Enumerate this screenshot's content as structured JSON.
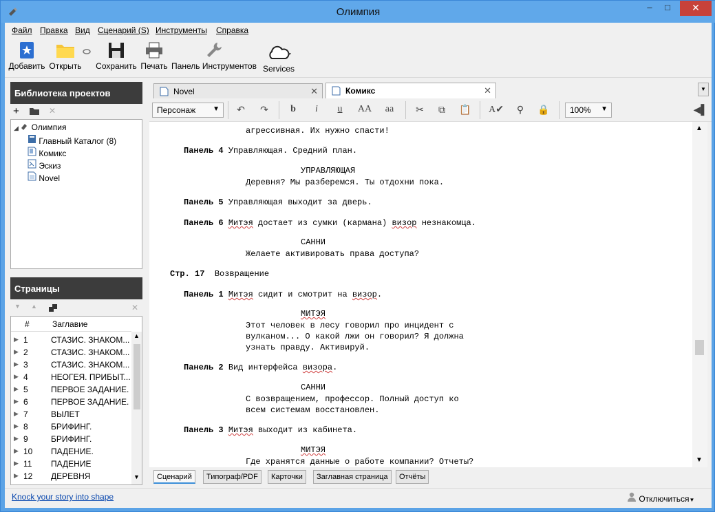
{
  "window": {
    "title": "Олимпия",
    "minimize": "–",
    "maximize": "□",
    "close": "✕"
  },
  "menu": [
    "Файл",
    "Правка",
    "Вид",
    "Сценарий (S)",
    "Инструменты",
    "Справка"
  ],
  "toolbar": {
    "add": "Добавить",
    "open": "Открыть",
    "save": "Сохранить",
    "print": "Печать",
    "panel": "Панель Инструментов",
    "services": "Services"
  },
  "library": {
    "header": "Библиотека проектов",
    "items": [
      "Олимпия",
      "Главный Каталог (8)",
      "Комикс",
      "Эскиз",
      "Novel"
    ]
  },
  "pages": {
    "header": "Страницы",
    "col_num": "#",
    "col_title": "Заглавие",
    "rows": [
      {
        "n": "1",
        "t": "СТАЗИС. ЗНАКОМ..."
      },
      {
        "n": "2",
        "t": "СТАЗИС. ЗНАКОМ..."
      },
      {
        "n": "3",
        "t": "СТАЗИС. ЗНАКОМ..."
      },
      {
        "n": "4",
        "t": "НЕОГЕЯ. ПРИБЫТ..."
      },
      {
        "n": "5",
        "t": "ПЕРВОЕ ЗАДАНИЕ."
      },
      {
        "n": "6",
        "t": "ПЕРВОЕ ЗАДАНИЕ."
      },
      {
        "n": "7",
        "t": "ВЫЛЕТ"
      },
      {
        "n": "8",
        "t": "БРИФИНГ."
      },
      {
        "n": "9",
        "t": "БРИФИНГ."
      },
      {
        "n": "10",
        "t": "ПАДЕНИЕ."
      },
      {
        "n": "11",
        "t": "ПАДЕНИЕ"
      },
      {
        "n": "12",
        "t": "ДЕРЕВНЯ"
      }
    ]
  },
  "tabs": {
    "novel": "Novel",
    "comics": "Комикс",
    "close": "✕"
  },
  "format": {
    "style": "Персонаж",
    "zoom": "100%"
  },
  "script": {
    "l1": "агрессивная. Их нужно спасти!",
    "p4_label": "Панель 4",
    "p4_text": "Управляющая. Средний план.",
    "char1": "УПРАВЛЯЮЩАЯ",
    "d1": "Деревня? Мы разберемся. Ты отдохни пока.",
    "p5_label": "Панель 5",
    "p5_text": "Управляющая выходит за дверь.",
    "p6_label": "Панель 6",
    "p6_a": "Митэя",
    "p6_b": "достает из сумки (кармана)",
    "p6_c": "визор",
    "p6_d": "незнакомца.",
    "char2": "САННИ",
    "d2": "Желаете активировать права доступа?",
    "page17": "Стр. 17",
    "page17_title": "Возвращение",
    "q1_label": "Панель 1",
    "q1_a": "Митэя",
    "q1_b": "сидит и смотрит на",
    "q1_c": "визор",
    "q1_d": ".",
    "char3": "МИТЭЯ",
    "d3a": "Этот человек в лесу говорил про инцидент с",
    "d3b": "вулканом... О какой лжи он говорил? Я должна",
    "d3c": "узнать правду. Активируй.",
    "q2_label": "Панель 2",
    "q2_a": "Вид интерфейса",
    "q2_b": "визора",
    "q2_c": ".",
    "char4": "САННИ",
    "d4a": "С возвращением, профессор. Полный доступ ко",
    "d4b": "всем системам восстановлен.",
    "q3_label": "Панель 3",
    "q3_a": "Митэя",
    "q3_b": "выходит из кабинета.",
    "char5": "МИТЭЯ",
    "d5": "Где хранятся данные о работе компании? Отчеты?"
  },
  "bottom_tabs": [
    "Сценарий",
    "Типограф/PDF",
    "Карточки",
    "Заглавная страница",
    "Отчёты"
  ],
  "status": {
    "link": "Knock your story into shape",
    "user": "Отключиться"
  }
}
